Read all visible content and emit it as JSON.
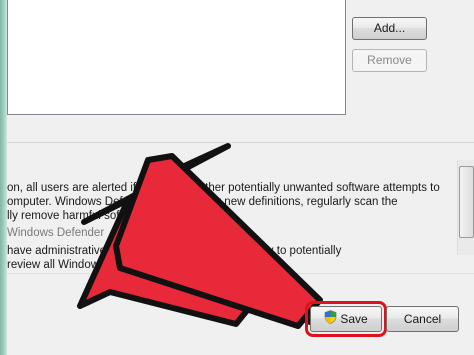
{
  "buttons": {
    "add": "Add...",
    "remove": "Remove",
    "save": "Save",
    "cancel": "Cancel"
  },
  "text_lines": [
    "on, all users are alerted if spyware or other potentially unwanted software attempts to",
    "omputer. Windows Defender will check for new definitions, regularly scan the",
    "lly remove harmful software.",
    "Windows Defender",
    "have administrative rights to choose actions to apply to potentially",
    "review all Windows Defender items."
  ],
  "colors": {
    "highlight": "#e0101c",
    "arrow_fill": "#e8293a",
    "arrow_outline": "#111111"
  },
  "icons": {
    "save": "shield-icon"
  }
}
